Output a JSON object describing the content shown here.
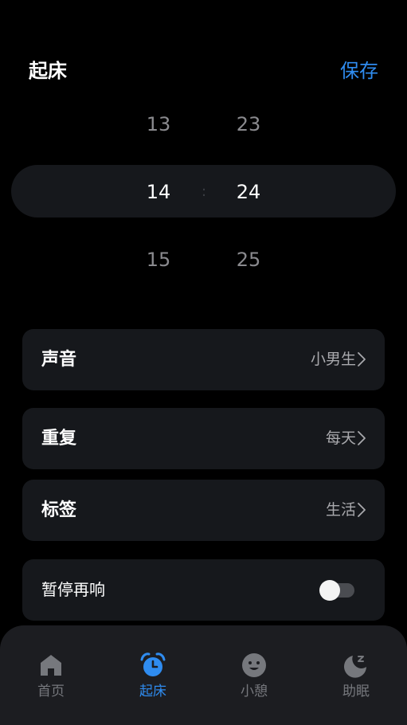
{
  "header": {
    "title": "起床",
    "save_label": "保存"
  },
  "time_picker": {
    "hours": {
      "prev": "13",
      "current": "14",
      "next": "15"
    },
    "minutes": {
      "prev": "23",
      "current": "24",
      "next": "25"
    },
    "separator": ":"
  },
  "settings": {
    "sound": {
      "label": "声音",
      "value": "小男生"
    },
    "repeat": {
      "label": "重复",
      "value": "每天"
    },
    "tag": {
      "label": "标签",
      "value": "生活"
    },
    "snooze": {
      "label": "暂停再响",
      "enabled": false
    }
  },
  "tabs": [
    {
      "label": "首页",
      "icon": "home-icon",
      "active": false
    },
    {
      "label": "起床",
      "icon": "alarm-clock-icon",
      "active": true
    },
    {
      "label": "小憩",
      "icon": "smile-face-icon",
      "active": false
    },
    {
      "label": "助眠",
      "icon": "moon-sleep-icon",
      "active": false
    }
  ],
  "colors": {
    "accent": "#2f8cf0",
    "background": "#000000",
    "card": "#16181c",
    "tabbar": "#1c1d21",
    "inactive": "#76787d"
  }
}
